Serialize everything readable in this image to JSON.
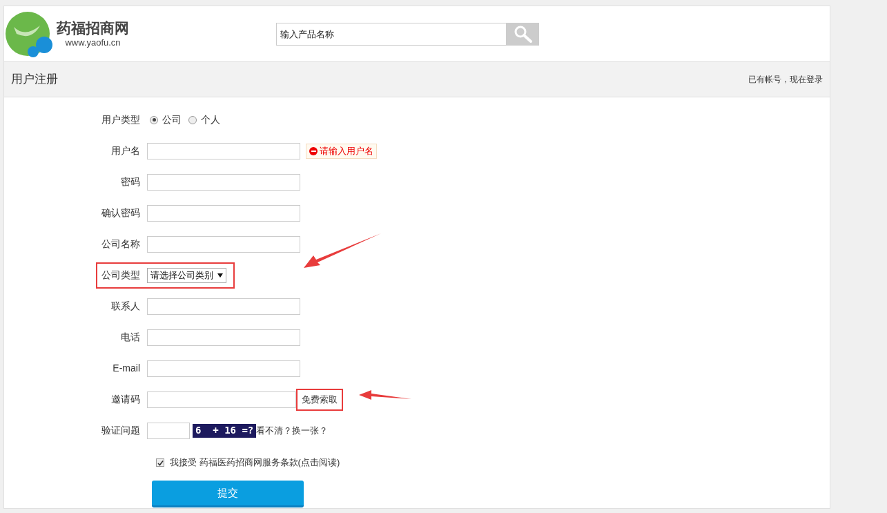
{
  "header": {
    "logo_name": "药福招商网",
    "logo_url": "www.yaofu.cn",
    "search": {
      "placeholder": "输入产品名称"
    }
  },
  "panel": {
    "title": "用户注册",
    "login_link": "已有帐号，现在登录"
  },
  "fields": [
    {
      "kind": "radio",
      "label": "用户类型",
      "highlighted": false,
      "options": [
        {
          "label": "公司",
          "selected": true
        },
        {
          "label": "个人",
          "selected": false
        }
      ]
    },
    {
      "kind": "text",
      "label": "用户名",
      "highlighted": false,
      "error": "请输入用户名"
    },
    {
      "kind": "text",
      "label": "密码",
      "highlighted": false
    },
    {
      "kind": "text",
      "label": "确认密码",
      "highlighted": false
    },
    {
      "kind": "text",
      "label": "公司名称",
      "highlighted": false
    },
    {
      "kind": "select",
      "label": "公司类型",
      "highlighted": true,
      "value": "请选择公司类别"
    },
    {
      "kind": "text",
      "label": "联系人",
      "highlighted": false
    },
    {
      "kind": "text",
      "label": "电话",
      "highlighted": false
    },
    {
      "kind": "text",
      "label": "E-mail",
      "highlighted": false
    },
    {
      "kind": "invite",
      "label": "邀请码",
      "highlighted": false,
      "button": "免费索取",
      "button_highlighted": true
    },
    {
      "kind": "captcha",
      "label": "验证问题",
      "captcha": "6  + 16 =?",
      "refresh": "看不清？换一张？",
      "highlighted": false
    }
  ],
  "agreement": {
    "checked": true,
    "text": "我接受 药福医药招商网服务条款(点击阅读)"
  },
  "submit": "提交"
}
